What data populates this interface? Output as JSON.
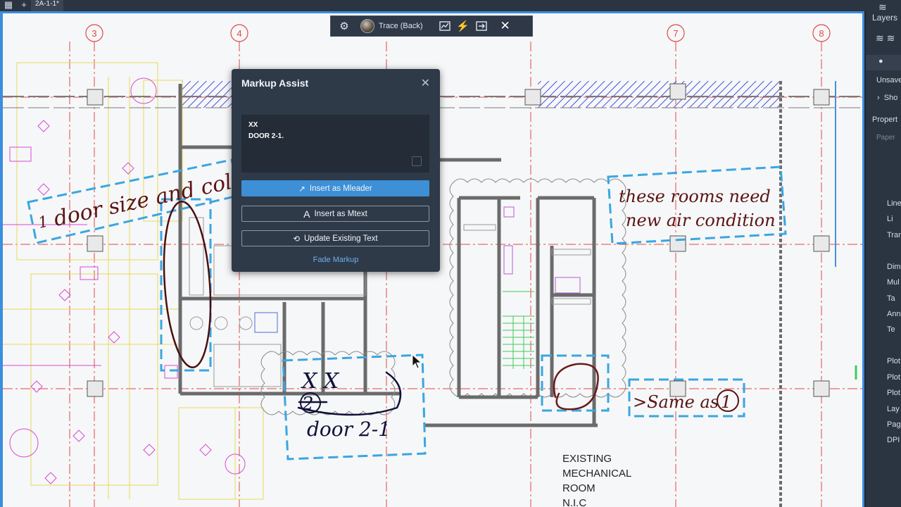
{
  "topbar": {
    "tab_title": "2A-1-1*"
  },
  "toolbar": {
    "trace_label": "Trace (Back)"
  },
  "markup_assist": {
    "title": "Markup Assist",
    "text_lines": [
      "XX",
      "DOOR 2-1."
    ],
    "insert_mleader_label": "Insert as Mleader",
    "insert_mtext_label": "Insert as Mtext",
    "update_text_label": "Update Existing Text",
    "fade_markup_label": "Fade Markup"
  },
  "drawing": {
    "grid_labels": [
      "3",
      "4",
      "7",
      "8"
    ],
    "room_label_lines": [
      "EXISTING",
      "MECHANICAL",
      "ROOM",
      "N.I.C"
    ],
    "handwritten": {
      "note1": "door size and color",
      "note1_marker": "1",
      "note2": "these rooms need new air condition",
      "note3_x": "X X",
      "note3_circled": "2",
      "note3_door": "door 2-1",
      "note4": ">Same as",
      "note4_circled": "1"
    }
  },
  "right_panel": {
    "layers_label": "Layers",
    "unsaved_label": "Unsave",
    "show_label": "Sho",
    "properties_label": "Propert",
    "paper_label": "Paper",
    "props": [
      "Line",
      "Li",
      "Tran",
      "Dim",
      "Mul",
      "Ta",
      "Ann",
      "Te",
      "Plot",
      "Plot",
      "Plot",
      "Lay",
      "Pag",
      "DPI"
    ]
  },
  "colors": {
    "accent": "#3d8fd6",
    "markup_blue": "#3aa6e0",
    "ink_red": "#6b1a1a",
    "ink_navy": "#10123a",
    "grid_red": "#e04848"
  }
}
